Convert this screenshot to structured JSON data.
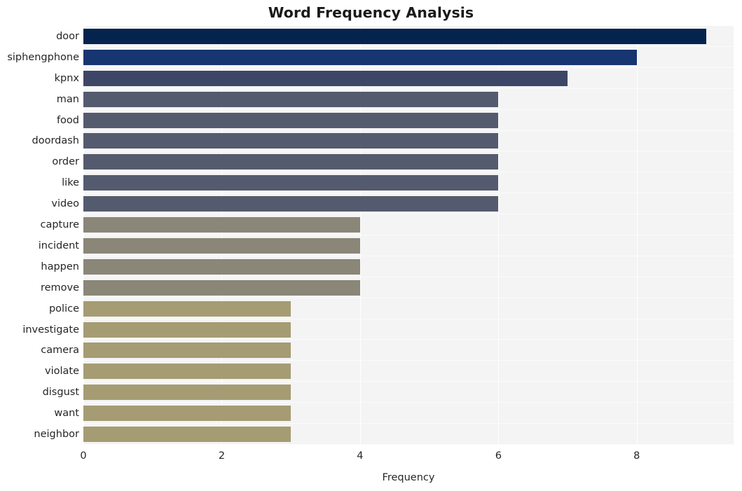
{
  "chart_data": {
    "type": "bar",
    "orientation": "horizontal",
    "title": "Word Frequency Analysis",
    "xlabel": "Frequency",
    "ylabel": "",
    "categories": [
      "door",
      "siphengphone",
      "kpnx",
      "man",
      "food",
      "doordash",
      "order",
      "like",
      "video",
      "capture",
      "incident",
      "happen",
      "remove",
      "police",
      "investigate",
      "camera",
      "violate",
      "disgust",
      "want",
      "neighbor"
    ],
    "values": [
      9,
      8,
      7,
      6,
      6,
      6,
      6,
      6,
      6,
      4,
      4,
      4,
      4,
      3,
      3,
      3,
      3,
      3,
      3,
      3
    ],
    "bar_colors": [
      "#04244d",
      "#173570",
      "#3e4668",
      "#555b6e",
      "#555b6e",
      "#555b6e",
      "#555b6e",
      "#555b6e",
      "#555b6e",
      "#8a8678",
      "#8a8678",
      "#8a8678",
      "#8a8678",
      "#a59c73",
      "#a59c73",
      "#a59c73",
      "#a59c73",
      "#a59c73",
      "#a59c73",
      "#a59c73"
    ],
    "xlim": [
      0,
      9.4
    ],
    "xticks": [
      0,
      2,
      4,
      6,
      8
    ],
    "xtick_labels": [
      "0",
      "2",
      "4",
      "6",
      "8"
    ],
    "grid": true,
    "grid_axis": "x",
    "legend": "none",
    "plot_background": "#f4f4f5",
    "figure_background": "#ffffff"
  }
}
